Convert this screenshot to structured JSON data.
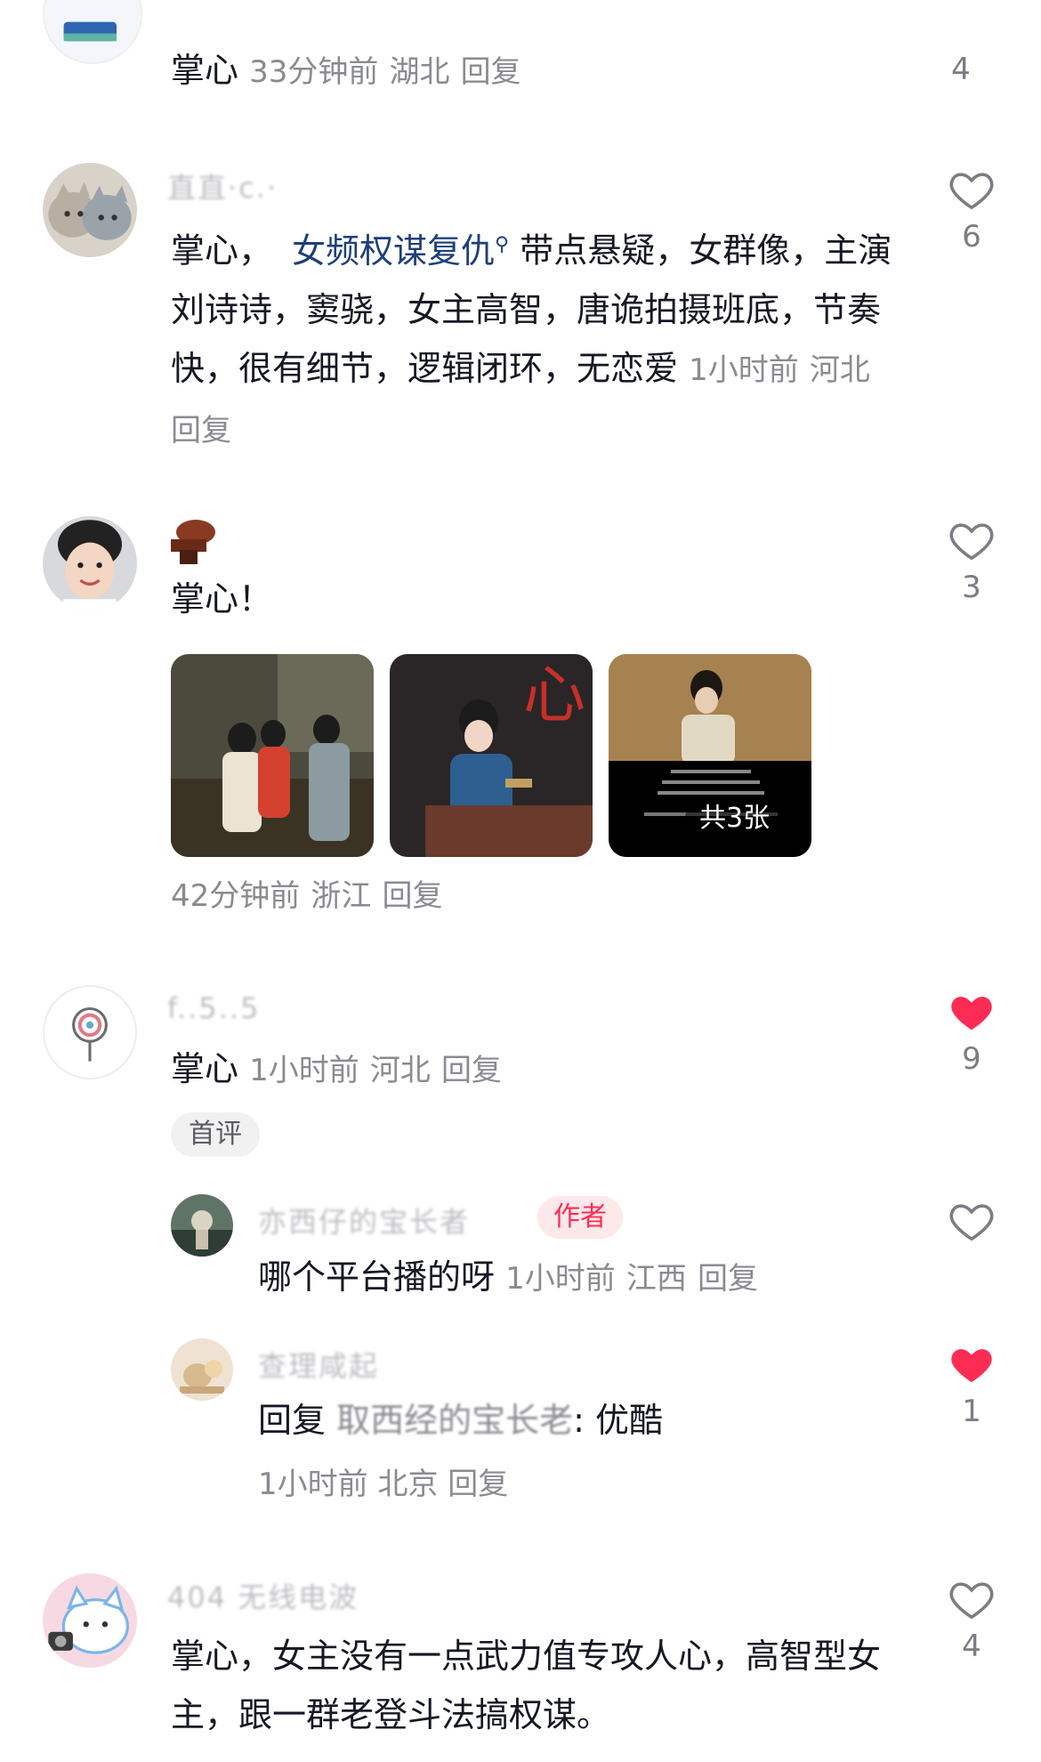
{
  "comments": [
    {
      "id": "c0",
      "text": "掌心",
      "time": "33分钟前",
      "location": "湖北",
      "reply_label": "回复",
      "likes": "4",
      "liked": false
    },
    {
      "id": "c1",
      "username": "直直·c.·",
      "text_lead": "掌心，",
      "search_link": "女频权谋复仇",
      "text_rest": "带点悬疑，女群像，主演刘诗诗，窦骁，女主高智，唐诡拍摄班底，节奏快，很有细节，逻辑闭环，无恋爱",
      "time": "1小时前",
      "location": "河北",
      "reply_label": "回复",
      "likes": "6",
      "liked": false
    },
    {
      "id": "c2",
      "text": "掌心！",
      "photo_count_label": "共3张",
      "time": "42分钟前",
      "location": "浙江",
      "reply_label": "回复",
      "likes": "3",
      "liked": false
    },
    {
      "id": "c3",
      "username": "f..5..5",
      "text": "掌心",
      "time": "1小时前",
      "location": "河北",
      "reply_label": "回复",
      "badge": "首评",
      "likes": "9",
      "liked": true,
      "replies": [
        {
          "username": "亦西仔的宝长者",
          "author_tag": "作者",
          "text": "哪个平台播的呀",
          "time": "1小时前",
          "location": "江西",
          "reply_label": "回复",
          "likes": "",
          "liked": false
        },
        {
          "username": "查理咸起",
          "reply_prefix": "回复",
          "reply_to": "取西经的宝长老",
          "text": ": 优酷",
          "time": "1小时前",
          "location": "北京",
          "reply_label": "回复",
          "likes": "1",
          "liked": true
        }
      ]
    },
    {
      "id": "c4",
      "username": "404 无线电波",
      "text": "掌心，女主没有一点武力值专攻人心，高智型女主，跟一群老登斗法搞权谋。",
      "likes": "4",
      "liked": false
    }
  ],
  "colors": {
    "text": "#161823",
    "meta": "#8a8b91",
    "link": "#1f3f78",
    "liked_red": "#fe2c55",
    "author_tag_bg": "#fde8ea"
  }
}
